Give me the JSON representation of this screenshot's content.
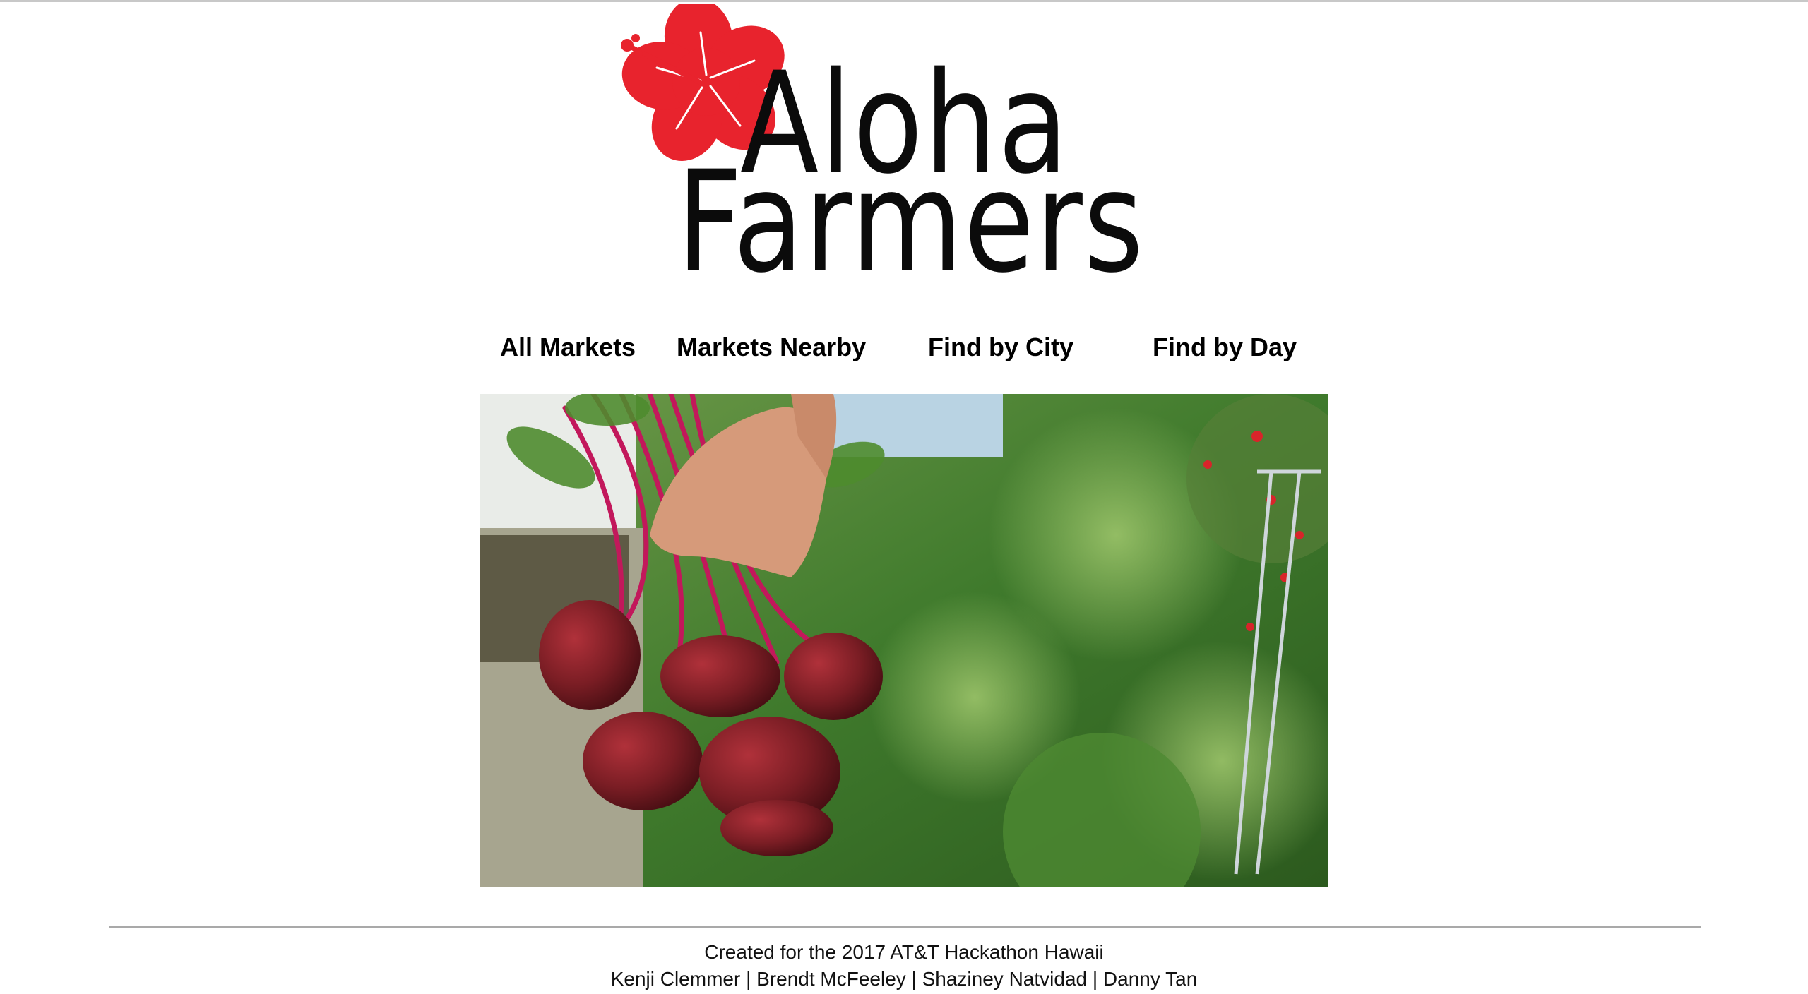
{
  "logo": {
    "line1": "Aloha",
    "line2": "Farmers",
    "icon": "hibiscus-flower-icon",
    "flower_color": "#e8232d"
  },
  "nav": {
    "items": [
      {
        "label": "All Markets"
      },
      {
        "label": "Markets Nearby"
      },
      {
        "label": "Find by City"
      },
      {
        "label": "Find by Day"
      }
    ]
  },
  "hero": {
    "image": "hand-holding-beets-photo"
  },
  "footer": {
    "line1": "Created for the 2017 AT&T Hackathon Hawaii",
    "line2": "Kenji Clemmer | Brendt McFeeley | Shaziney Natvidad | Danny Tan"
  }
}
